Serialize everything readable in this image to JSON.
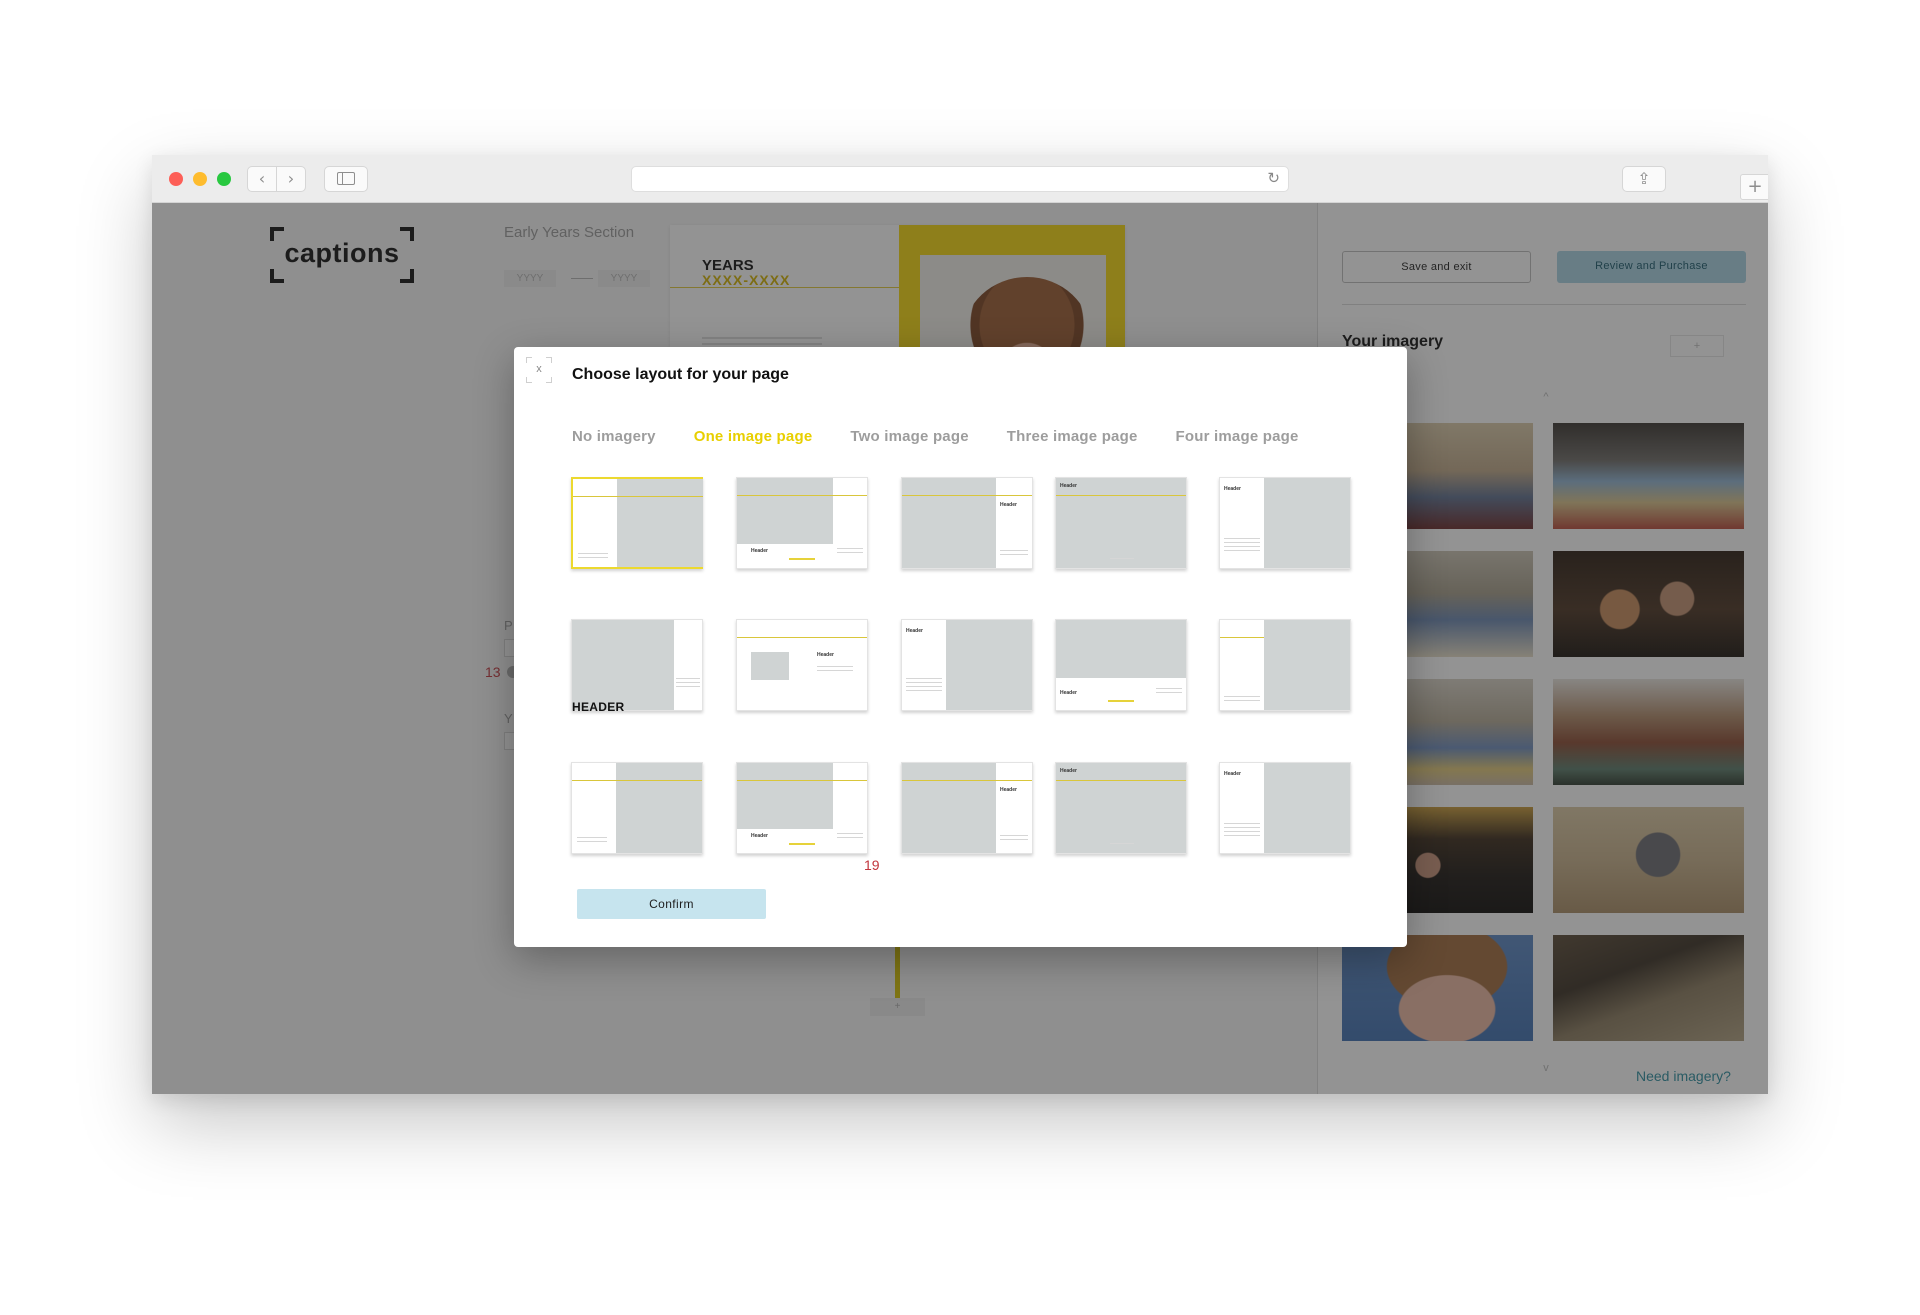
{
  "browser": {
    "nav_back": "‹",
    "nav_forward": "›",
    "reload": "↻",
    "new_tab": "+",
    "share_icon": "⇪",
    "tabs_icon": "⧉"
  },
  "app": {
    "logo_text": "captions",
    "section": {
      "title": "Early Years Section",
      "year_from_placeholder": "YYYY",
      "year_to_placeholder": "YYYY"
    },
    "left_fields": {
      "label_p": "P",
      "label_y": "Y",
      "number": "13"
    },
    "spread": {
      "heading": "YEARS",
      "subheading": "XXXX-XXXX"
    },
    "timeline_add": "+"
  },
  "right_panel": {
    "save_label": "Save and exit",
    "review_label": "Review and Purchase",
    "imagery_title": "Your imagery",
    "add_label": "+",
    "scroll_up": "^",
    "scroll_down": "v",
    "need_imagery": "Need imagery?"
  },
  "modal": {
    "close_label": "x",
    "title": "Choose layout for your page",
    "tabs": [
      {
        "label": "No imagery",
        "active": false
      },
      {
        "label": "One image page",
        "active": true
      },
      {
        "label": "Two image page",
        "active": false
      },
      {
        "label": "Three image page",
        "active": false
      },
      {
        "label": "Four image page",
        "active": false
      }
    ],
    "thumb_header_label": "Header",
    "thumb_header_big": "HEADER",
    "page_number": "19",
    "confirm_label": "Confirm"
  },
  "colors": {
    "accent_yellow": "#e8cf00",
    "review_blue": "#a8d3e3",
    "confirm_blue": "#c6e4ee",
    "link_teal": "#2d8fa0",
    "number_red": "#c2353c"
  }
}
